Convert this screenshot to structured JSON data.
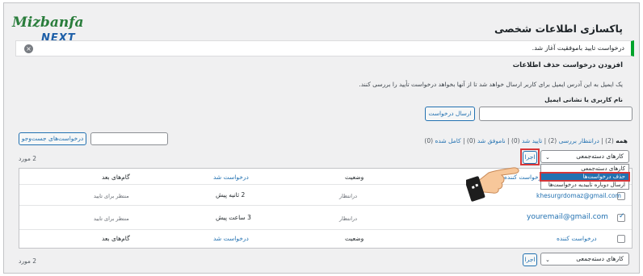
{
  "logo": {
    "line1": "Mizbanfa",
    "line2": "NEXT"
  },
  "page_title": "پاکسازی اطلاعات شخصی",
  "notice": {
    "text": "درخواست تایید باموفقیت آغاز شد.",
    "dismiss_icon": "×"
  },
  "section_title": "افزودن درخواست حذف اطلاعات",
  "description": "یک ایمیل به این آدرس ایمیل برای کاربر ارسال خواهد شد تا از آنها بخواهد درخواست تأیید را بررسی کنند.",
  "user_label": "نام کاربری یا نشانی ایمیل",
  "send_button": "ارسال درخواست",
  "search_button": "درخواست‌های جست‌وجو",
  "filters": {
    "all": "همه",
    "all_count": "(2)",
    "pending": "درانتظار بررسی",
    "pending_count": "(2)",
    "confirmed": "تایید شد",
    "confirmed_count": "(0)",
    "failed": "ناموفق شد",
    "failed_count": "(0)",
    "completed": "کامل شده",
    "completed_count": "(0)",
    "sep": "|"
  },
  "bulk": {
    "selected": "کارهای دسته‌جمعی",
    "apply": "اجرا",
    "options": [
      "کارهای دسته‌جمعی",
      "حذف درخواست‌ها",
      "ارسال دوباره تاییدیه درخواست‌ها"
    ]
  },
  "count": "2 مورد",
  "table": {
    "headers": {
      "requester": "درخواست کننده",
      "status": "وضعیت",
      "requested": "درخواست شد",
      "next": "گام‌های بعد"
    },
    "rows": [
      {
        "email": "khesurgrdomaz@gmail.com",
        "status": "درانتظار",
        "time": "2 ثانیه پیش",
        "next": "منتظر برای تایید",
        "checked": false
      },
      {
        "email": "youremail@gmail.com",
        "status": "درانتظار",
        "time": "3 ساعت پیش",
        "next": "منتظر برای تایید",
        "checked": true
      }
    ]
  },
  "colors": {
    "accent": "#2271b1",
    "success": "#00a32a",
    "highlight": "#d63638"
  }
}
